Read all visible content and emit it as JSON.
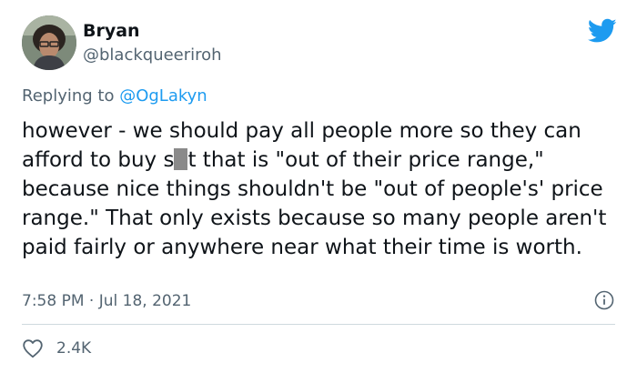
{
  "author": {
    "display_name": "Bryan",
    "handle": "@blackqueeriroh"
  },
  "reply": {
    "prefix": "Replying to ",
    "mention": "@OgLakyn"
  },
  "tweet": {
    "text_before_censor": "however - we should pay all people more so they can afford to buy s",
    "text_after_censor": "t that is \"out of their price range,\" because nice things shouldn't be \"out of people's' price range.\" That only exists because so many people aren't paid fairly or anywhere near what their time is worth."
  },
  "meta": {
    "timestamp": "7:58 PM · Jul 18, 2021"
  },
  "actions": {
    "like_count": "2.4K"
  },
  "icons": {
    "brand": "twitter-bird-icon",
    "info": "info-icon",
    "like": "heart-icon"
  },
  "colors": {
    "brand_blue": "#1d9bf0",
    "secondary_text": "#536471",
    "divider": "#cfd9de"
  }
}
